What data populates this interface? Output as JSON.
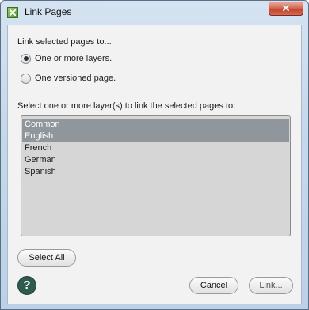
{
  "window": {
    "title": "Link Pages",
    "close_glyph": "✕"
  },
  "dialog": {
    "link_prompt": "Link selected pages to...",
    "options": [
      {
        "label": "One or more layers.",
        "selected": true
      },
      {
        "label": "One versioned page.",
        "selected": false
      }
    ],
    "list_prompt": "Select one or more layer(s) to link the selected pages to:",
    "layers": [
      {
        "label": "Common",
        "selected": true
      },
      {
        "label": "English",
        "selected": true
      },
      {
        "label": "French",
        "selected": false
      },
      {
        "label": "German",
        "selected": false
      },
      {
        "label": "Spanish",
        "selected": false
      }
    ],
    "select_all_label": "Select All",
    "help_glyph": "?",
    "cancel_label": "Cancel",
    "link_label": "Link..."
  }
}
